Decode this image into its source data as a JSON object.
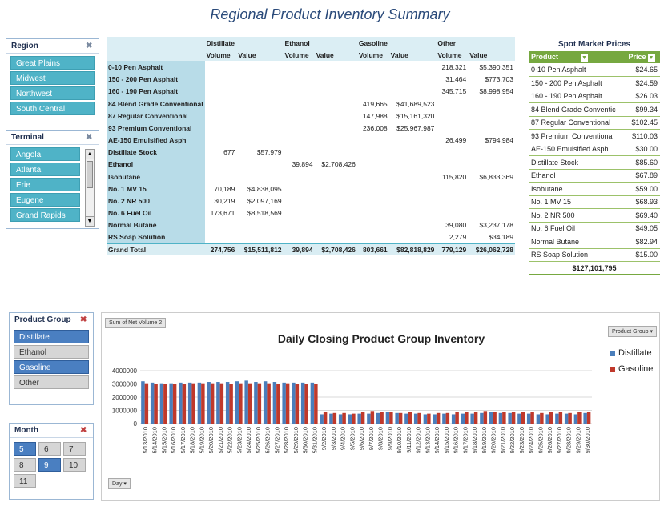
{
  "title": "Regional Product Inventory Summary",
  "colors": {
    "distillate": "#4a7ebb",
    "gasoline": "#c0392b",
    "slicer_teal": "#4fb3c7",
    "slicer_blue": "#4a7fc1",
    "spot_header": "#76a840"
  },
  "region_slicer": {
    "title": "Region",
    "items": [
      {
        "label": "Great Plains"
      },
      {
        "label": "Midwest"
      },
      {
        "label": "Northwest"
      },
      {
        "label": "South Central"
      }
    ]
  },
  "terminal_slicer": {
    "title": "Terminal",
    "items": [
      {
        "label": "Angola"
      },
      {
        "label": "Atlanta"
      },
      {
        "label": "Erie"
      },
      {
        "label": "Eugene"
      },
      {
        "label": "Grand Rapids"
      }
    ]
  },
  "product_group_slicer": {
    "title": "Product Group",
    "items": [
      {
        "label": "Distillate",
        "selected": true
      },
      {
        "label": "Ethanol",
        "selected": false
      },
      {
        "label": "Gasoline",
        "selected": true
      },
      {
        "label": "Other",
        "selected": false
      }
    ]
  },
  "month_slicer": {
    "title": "Month",
    "items": [
      {
        "label": "5",
        "selected": true
      },
      {
        "label": "6",
        "selected": false
      },
      {
        "label": "7",
        "selected": false
      },
      {
        "label": "8",
        "selected": false
      },
      {
        "label": "9",
        "selected": true
      },
      {
        "label": "10",
        "selected": false
      },
      {
        "label": "11",
        "selected": false
      }
    ]
  },
  "pivot": {
    "groups": [
      "Distillate",
      "Ethanol",
      "Gasoline",
      "Other"
    ],
    "sub_headers": [
      "Volume",
      "Value"
    ],
    "rows": [
      {
        "label": "0-10 Pen Asphalt",
        "cells": [
          "",
          "",
          "",
          "",
          "",
          "",
          "218,321",
          "$5,390,351"
        ]
      },
      {
        "label": "150 - 200 Pen Asphalt",
        "cells": [
          "",
          "",
          "",
          "",
          "",
          "",
          "31,464",
          "$773,703"
        ]
      },
      {
        "label": "160 - 190 Pen Asphalt",
        "cells": [
          "",
          "",
          "",
          "",
          "",
          "",
          "345,715",
          "$8,998,954"
        ]
      },
      {
        "label": "84 Blend Grade Conventional",
        "cells": [
          "",
          "",
          "",
          "",
          "419,665",
          "$41,689,523",
          "",
          ""
        ]
      },
      {
        "label": "87 Regular Conventional",
        "cells": [
          "",
          "",
          "",
          "",
          "147,988",
          "$15,161,320",
          "",
          ""
        ]
      },
      {
        "label": "93 Premium Conventional",
        "cells": [
          "",
          "",
          "",
          "",
          "236,008",
          "$25,967,987",
          "",
          ""
        ]
      },
      {
        "label": "AE-150 Emulsified Asph",
        "cells": [
          "",
          "",
          "",
          "",
          "",
          "",
          "26,499",
          "$794,984"
        ]
      },
      {
        "label": "Distillate Stock",
        "cells": [
          "677",
          "$57,979",
          "",
          "",
          "",
          "",
          "",
          ""
        ]
      },
      {
        "label": "Ethanol",
        "cells": [
          "",
          "",
          "39,894",
          "$2,708,426",
          "",
          "",
          "",
          ""
        ]
      },
      {
        "label": "Isobutane",
        "cells": [
          "",
          "",
          "",
          "",
          "",
          "",
          "115,820",
          "$6,833,369"
        ]
      },
      {
        "label": "No. 1 MV 15",
        "cells": [
          "70,189",
          "$4,838,095",
          "",
          "",
          "",
          "",
          "",
          ""
        ]
      },
      {
        "label": "No. 2 NR 500",
        "cells": [
          "30,219",
          "$2,097,169",
          "",
          "",
          "",
          "",
          "",
          ""
        ]
      },
      {
        "label": "No. 6 Fuel Oil",
        "cells": [
          "173,671",
          "$8,518,569",
          "",
          "",
          "",
          "",
          "",
          ""
        ]
      },
      {
        "label": "Normal Butane",
        "cells": [
          "",
          "",
          "",
          "",
          "",
          "",
          "39,080",
          "$3,237,178"
        ]
      },
      {
        "label": "RS Soap Solution",
        "cells": [
          "",
          "",
          "",
          "",
          "",
          "",
          "2,279",
          "$34,189"
        ]
      }
    ],
    "grand_total": {
      "label": "Grand Total",
      "cells": [
        "274,756",
        "$15,511,812",
        "39,894",
        "$2,708,426",
        "803,661",
        "$82,818,829",
        "779,129",
        "$26,062,728"
      ]
    }
  },
  "spot": {
    "title": "Spot Market Prices",
    "col_product": "Product",
    "col_price": "Price",
    "rows": [
      {
        "product": "0-10 Pen Asphalt",
        "price": "$24.65"
      },
      {
        "product": "150 - 200 Pen Asphalt",
        "price": "$24.59"
      },
      {
        "product": "160 - 190 Pen Asphalt",
        "price": "$26.03"
      },
      {
        "product": "84 Blend Grade Conventic",
        "price": "$99.34"
      },
      {
        "product": "87 Regular Conventional",
        "price": "$102.45"
      },
      {
        "product": "93 Premium Conventiona",
        "price": "$110.03"
      },
      {
        "product": "AE-150 Emulsified Asph",
        "price": "$30.00"
      },
      {
        "product": "Distillate Stock",
        "price": "$85.60"
      },
      {
        "product": "Ethanol",
        "price": "$67.89"
      },
      {
        "product": "Isobutane",
        "price": "$59.00"
      },
      {
        "product": "No. 1 MV 15",
        "price": "$68.93"
      },
      {
        "product": "No. 2 NR 500",
        "price": "$69.40"
      },
      {
        "product": "No. 6 Fuel Oil",
        "price": "$49.05"
      },
      {
        "product": "Normal Butane",
        "price": "$82.94"
      },
      {
        "product": "RS Soap Solution",
        "price": "$15.00"
      }
    ],
    "total": "$127,101,795"
  },
  "chart_field_value": "Sum of Net Volume 2",
  "chart_field_axis": "Day",
  "chart_field_legend": "Product Group",
  "chart_data": {
    "type": "bar",
    "title": "Daily Closing Product Group Inventory",
    "ylim": [
      0,
      4000000
    ],
    "yticks": [
      "4000000",
      "3000000",
      "2000000",
      "1000000",
      "0"
    ],
    "grid": true,
    "legend_position": "right",
    "categories": [
      "5/13/2010",
      "5/14/2010",
      "5/15/2010",
      "5/16/2010",
      "5/17/2010",
      "5/18/2010",
      "5/19/2010",
      "5/20/2010",
      "5/21/2010",
      "5/22/2010",
      "5/23/2010",
      "5/24/2010",
      "5/25/2010",
      "5/26/2010",
      "5/27/2010",
      "5/28/2010",
      "5/29/2010",
      "5/30/2010",
      "5/31/2010",
      "9/2/2010",
      "9/3/2010",
      "9/4/2010",
      "9/5/2010",
      "9/6/2010",
      "9/7/2010",
      "9/8/2010",
      "9/9/2010",
      "9/10/2010",
      "9/11/2010",
      "9/12/2010",
      "9/13/2010",
      "9/14/2010",
      "9/15/2010",
      "9/16/2010",
      "9/17/2010",
      "9/18/2010",
      "9/19/2010",
      "9/20/2010",
      "9/21/2010",
      "9/22/2010",
      "9/23/2010",
      "9/24/2010",
      "9/25/2010",
      "9/26/2010",
      "9/27/2010",
      "9/28/2010",
      "9/29/2010",
      "9/30/2010"
    ],
    "series": [
      {
        "name": "Distillate",
        "values": [
          3200000,
          3100000,
          3050000,
          3050000,
          3100000,
          3100000,
          3100000,
          3150000,
          3150000,
          3150000,
          3200000,
          3250000,
          3150000,
          3200000,
          3150000,
          3100000,
          3100000,
          3100000,
          3100000,
          700000,
          750000,
          700000,
          700000,
          750000,
          750000,
          800000,
          850000,
          800000,
          750000,
          750000,
          700000,
          700000,
          750000,
          700000,
          750000,
          750000,
          800000,
          850000,
          800000,
          800000,
          750000,
          750000,
          700000,
          700000,
          750000,
          750000,
          700000,
          800000
        ]
      },
      {
        "name": "Gasoline",
        "values": [
          3050000,
          3000000,
          3000000,
          3000000,
          3000000,
          3050000,
          3050000,
          3050000,
          3050000,
          3000000,
          3050000,
          3050000,
          3050000,
          3050000,
          3000000,
          3050000,
          3000000,
          3000000,
          3000000,
          850000,
          800000,
          800000,
          750000,
          850000,
          950000,
          900000,
          850000,
          800000,
          850000,
          800000,
          750000,
          800000,
          800000,
          850000,
          850000,
          850000,
          950000,
          900000,
          850000,
          900000,
          850000,
          850000,
          800000,
          850000,
          850000,
          800000,
          850000,
          850000
        ]
      }
    ]
  }
}
